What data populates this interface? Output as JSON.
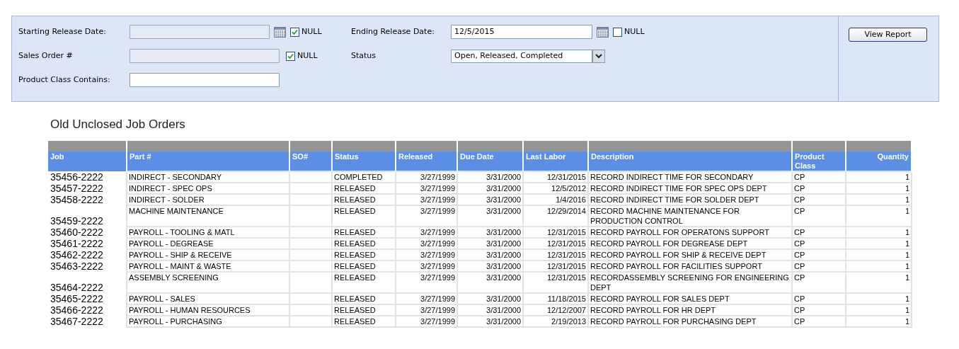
{
  "filters_left": [
    {
      "kind": "date",
      "label": "Starting Release Date:",
      "null_label": "NULL",
      "null_checked": true
    },
    {
      "kind": "text",
      "label": "Sales Order #",
      "null_label": "NULL",
      "null_checked": true
    },
    {
      "kind": "text",
      "label": "Product Class Contains:"
    }
  ],
  "filters_right": [
    {
      "kind": "date",
      "label": "Ending Release Date:",
      "value": "12/5/2015",
      "null_label": "NULL",
      "null_checked": false
    },
    {
      "kind": "select",
      "label": "Status",
      "value": "Open, Released, Completed"
    }
  ],
  "view_report_button": "View Report",
  "report_title": "Old Unclosed Job Orders",
  "table": {
    "columns": [
      "Job",
      "Part #",
      "SO#",
      "Status",
      "Released",
      "Due Date",
      "Last Labor",
      "Description",
      "Product Class",
      "Quantity"
    ],
    "rows": [
      [
        "35456-2222",
        "INDIRECT - SECONDARY",
        "",
        "COMPLETED",
        "3/27/1999",
        "3/31/2000",
        "12/31/2015",
        "RECORD INDIRECT TIME FOR SECONDARY",
        "CP",
        "1"
      ],
      [
        "35457-2222",
        "INDIRECT - SPEC OPS",
        "",
        "RELEASED",
        "3/27/1999",
        "3/31/2000",
        "12/5/2012",
        "RECORD INDIRECT TIME FOR SPEC OPS DEPT",
        "CP",
        "1"
      ],
      [
        "35458-2222",
        "INDIRECT - SOLDER",
        "",
        "RELEASED",
        "3/27/1999",
        "3/31/2000",
        "1/4/2016",
        "RECORD INDIRECT TIME FOR SOLDER DEPT",
        "CP",
        "1"
      ],
      [
        "35459-2222",
        "MACHINE MAINTENANCE",
        "",
        "RELEASED",
        "3/27/1999",
        "3/31/2000",
        "12/29/2014",
        "RECORD MACHINE MAINTENANCE FOR PRODUCTION CONTROL",
        "CP",
        "1"
      ],
      [
        "35460-2222",
        "PAYROLL - TOOLING & MATL",
        "",
        "RELEASED",
        "3/27/1999",
        "3/31/2000",
        "12/31/2015",
        "RECORD PAYROLL FOR OPERATONS SUPPORT",
        "CP",
        "1"
      ],
      [
        "35461-2222",
        "PAYROLL - DEGREASE",
        "",
        "RELEASED",
        "3/27/1999",
        "3/31/2000",
        "12/31/2015",
        "RECORD PAYROLL FOR DEGREASE DEPT",
        "CP",
        "1"
      ],
      [
        "35462-2222",
        "PAYROLL - SHIP & RECEIVE",
        "",
        "RELEASED",
        "3/27/1999",
        "3/31/2000",
        "12/31/2015",
        "RECORD PAYROLL FOR SHIP & RECEIVE DEPT",
        "CP",
        "1"
      ],
      [
        "35463-2222",
        "PAYROLL - MAINT & WASTE",
        "",
        "RELEASED",
        "3/27/1999",
        "3/31/2000",
        "12/31/2015",
        "RECORD PAYROLL FOR FACILITIES SUPPORT",
        "CP",
        "1"
      ],
      [
        "35464-2222",
        "ASSEMBLY SCREENING",
        "",
        "RELEASED",
        "3/27/1999",
        "3/31/2000",
        "12/31/2015",
        "RECORDASSEMBLY SCREENING FOR ENGINEERING DEPT",
        "CP",
        "1"
      ],
      [
        "35465-2222",
        "PAYROLL - SALES",
        "",
        "RELEASED",
        "3/27/1999",
        "3/31/2000",
        "11/18/2015",
        "RECORD PAYROLL FOR SALES DEPT",
        "CP",
        "1"
      ],
      [
        "35466-2222",
        "PAYROLL - HUMAN RESOURCES",
        "",
        "RELEASED",
        "3/27/1999",
        "3/31/2000",
        "12/12/2007",
        "RECORD PAYROLL FOR HR DEPT",
        "CP",
        "1"
      ],
      [
        "35467-2222",
        "PAYROLL - PURCHASING",
        "",
        "RELEASED",
        "3/27/1999",
        "3/31/2000",
        "2/19/2013",
        "RECORD PAYROLL FOR PURCHASING DEPT",
        "CP",
        "1"
      ]
    ]
  }
}
